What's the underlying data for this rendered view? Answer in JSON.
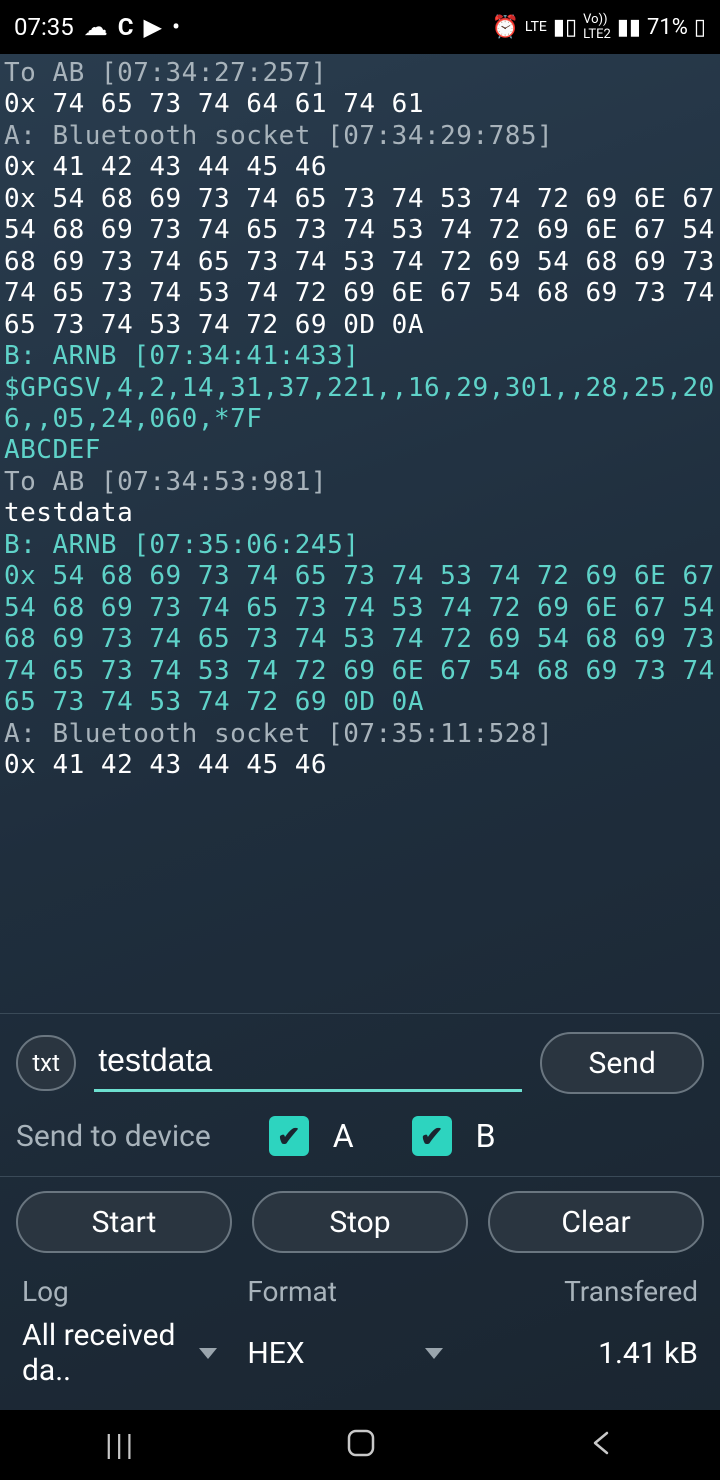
{
  "statusbar": {
    "time": "07:35",
    "battery": "71%"
  },
  "log": [
    {
      "cls": "c-gray",
      "text": "To AB [07:34:27:257]"
    },
    {
      "cls": "c-white",
      "text": "0x 74 65 73 74 64 61 74 61"
    },
    {
      "cls": "c-gray",
      "text": "A: Bluetooth socket [07:34:29:785]"
    },
    {
      "cls": "c-white",
      "text": "0x 41 42 43 44 45 46"
    },
    {
      "cls": "c-white",
      "text": "0x 54 68 69 73 74 65 73 74 53 74 72 69 6E 67 54 68 69 73 74 65 73 74 53 74 72 69 6E 67 54 68 69 73 74 65 73 74 53 74 72 69 54 68 69 73 74 65 73 74 53 74 72 69 6E 67 54 68 69 73 74 65 73 74 53 74 72 69 0D 0A"
    },
    {
      "cls": "c-cyan",
      "text": "B: ARNB [07:34:41:433]"
    },
    {
      "cls": "c-cyan",
      "text": "$GPGSV,4,2,14,31,37,221,,16,29,301,,28,25,206,,05,24,060,*7F"
    },
    {
      "cls": "c-cyan",
      "text": ""
    },
    {
      "cls": "c-cyan",
      "text": "ABCDEF"
    },
    {
      "cls": "c-gray",
      "text": "To AB [07:34:53:981]"
    },
    {
      "cls": "c-white",
      "text": "testdata"
    },
    {
      "cls": "c-cyan",
      "text": "B: ARNB [07:35:06:245]"
    },
    {
      "cls": "c-cyan",
      "text": "0x 54 68 69 73 74 65 73 74 53 74 72 69 6E 67 54 68 69 73 74 65 73 74 53 74 72 69 6E 67 54 68 69 73 74 65 73 74 53 74 72 69 54 68 69 73 74 65 73 74 53 74 72 69 6E 67 54 68 69 73 74 65 73 74 53 74 72 69 0D 0A"
    },
    {
      "cls": "c-gray",
      "text": "A: Bluetooth socket [07:35:11:528]"
    },
    {
      "cls": "c-white",
      "text": "0x 41 42 43 44 45 46"
    }
  ],
  "input": {
    "mode": "txt",
    "value": "testdata",
    "send": "Send"
  },
  "devices": {
    "label": "Send to device",
    "a": {
      "checked": true,
      "name": "A"
    },
    "b": {
      "checked": true,
      "name": "B"
    }
  },
  "controls": {
    "start": "Start",
    "stop": "Stop",
    "clear": "Clear"
  },
  "footer": {
    "log_label": "Log",
    "format_label": "Format",
    "transfer_label": "Transfered",
    "log_value": "All received da..",
    "format_value": "HEX",
    "transfer_value": "1.41 kB"
  }
}
